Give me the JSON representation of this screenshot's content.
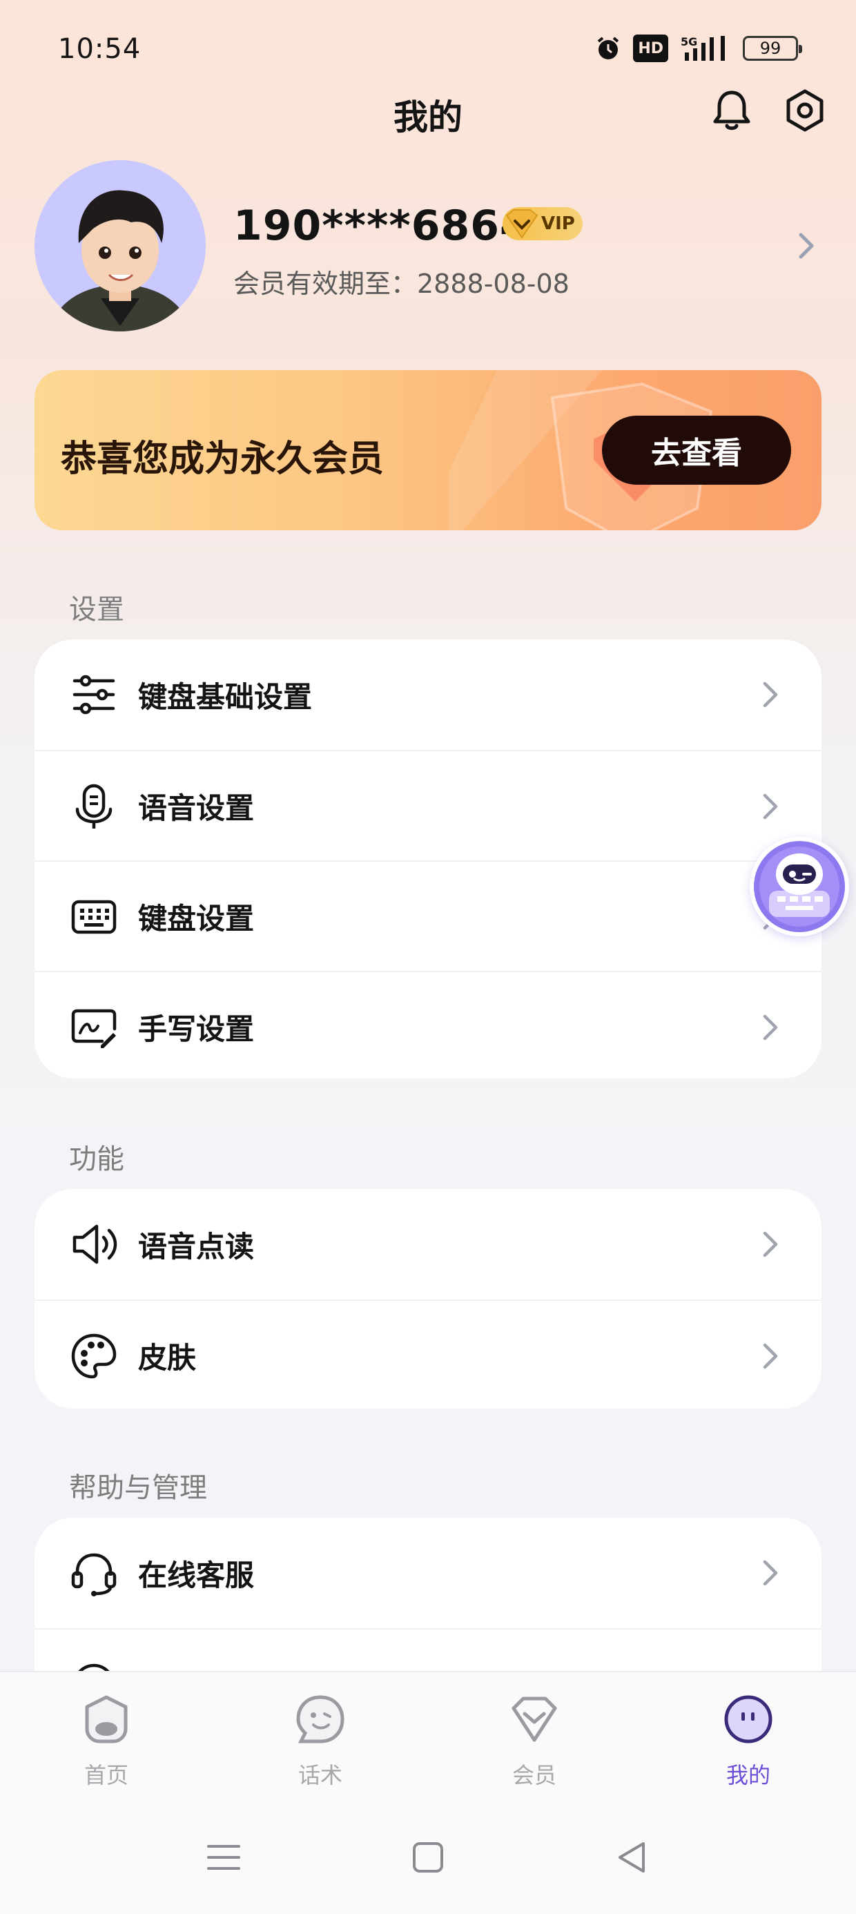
{
  "status_bar": {
    "time": "10:54",
    "network": "5G",
    "hd": "HD",
    "battery": "99"
  },
  "header": {
    "title": "我的"
  },
  "profile": {
    "phone": "190****6864",
    "vip_label": "VIP",
    "expiry": "会员有效期至：2888-08-08"
  },
  "banner": {
    "text": "恭喜您成为永久会员",
    "button_label": "去查看"
  },
  "sections": {
    "settings": {
      "title": "设置",
      "items": [
        {
          "label": "键盘基础设置",
          "icon": "sliders-icon"
        },
        {
          "label": "语音设置",
          "icon": "microphone-icon"
        },
        {
          "label": "键盘设置",
          "icon": "keyboard-icon"
        },
        {
          "label": "手写设置",
          "icon": "handwriting-icon"
        }
      ]
    },
    "features": {
      "title": "功能",
      "items": [
        {
          "label": "语音点读",
          "icon": "speaker-icon"
        },
        {
          "label": "皮肤",
          "icon": "palette-icon"
        }
      ]
    },
    "help": {
      "title": "帮助与管理",
      "items": [
        {
          "label": "在线客服",
          "icon": "headset-icon"
        }
      ]
    }
  },
  "bottom_nav": {
    "items": [
      {
        "label": "首页",
        "icon": "home-icon"
      },
      {
        "label": "话术",
        "icon": "chat-icon"
      },
      {
        "label": "会员",
        "icon": "diamond-icon"
      },
      {
        "label": "我的",
        "icon": "profile-icon",
        "active": true
      }
    ]
  },
  "colors": {
    "accent": "#6d4fd6",
    "banner_button": "#200b08",
    "vip_gold": "#f5c04a"
  }
}
